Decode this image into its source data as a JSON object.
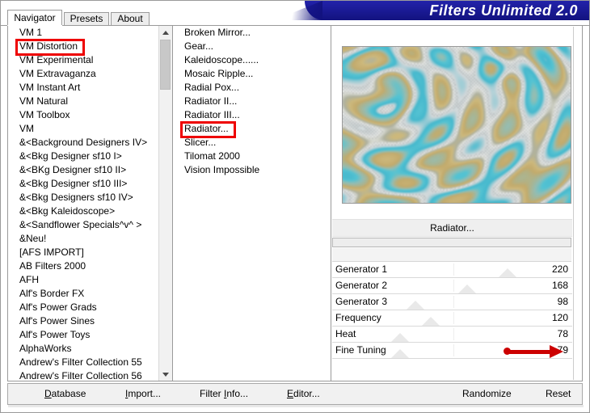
{
  "window": {
    "title": "Filters Unlimited 2.0",
    "accent_color": "#12127f",
    "annotation_color": "#cc0000"
  },
  "tabs": [
    {
      "label": "Navigator",
      "active": true
    },
    {
      "label": "Presets",
      "active": false
    },
    {
      "label": "About",
      "active": false
    }
  ],
  "categories": {
    "scrollbar": {
      "up_icon": "chevron-up-icon",
      "down_icon": "chevron-down-icon"
    },
    "selected": "VM Distortion",
    "items": [
      "VM 1",
      "VM Distortion",
      "VM Experimental",
      "VM Extravaganza",
      "VM Instant Art",
      "VM Natural",
      "VM Toolbox",
      "VM",
      "&<Background Designers IV>",
      "&<Bkg Designer sf10 I>",
      "&<BKg Designer sf10 II>",
      "&<Bkg Designer sf10 III>",
      "&<Bkg Designers sf10 IV>",
      "&<Bkg Kaleidoscope>",
      "&<Sandflower Specials^v^ >",
      "&Neu!",
      "[AFS IMPORT]",
      "AB Filters 2000",
      "AFH",
      "Alf's Border FX",
      "Alf's Power Grads",
      "Alf's Power Sines",
      "Alf's Power Toys",
      "AlphaWorks",
      "Andrew's Filter Collection 55",
      "Andrew's Filter Collection 56"
    ]
  },
  "filters": {
    "selected": "Radiator...",
    "items": [
      "Broken Mirror...",
      "Gear...",
      "Kaleidoscope......",
      "Mosaic Ripple...",
      "Radial Pox...",
      "Radiator II...",
      "Radiator III...",
      "Radiator...",
      "Slicer...",
      "Tilomat 2000",
      "Vision Impossible"
    ]
  },
  "preview": {
    "name": "filter-preview-image",
    "colors": [
      "#3fb8cf",
      "#c2a96b",
      "#ffffff",
      "#9fb8b2",
      "#d9d2b0"
    ]
  },
  "parameters": {
    "header": "Radiator...",
    "progress": 0,
    "rows": [
      {
        "label": "Generator 1",
        "value": 220,
        "pos": 0.87
      },
      {
        "label": "Generator 2",
        "value": 168,
        "pos": 0.66
      },
      {
        "label": "Generator 3",
        "value": 98,
        "pos": 0.39
      },
      {
        "label": "Frequency",
        "value": 120,
        "pos": 0.47
      },
      {
        "label": "Heat",
        "value": 78,
        "pos": 0.31
      },
      {
        "label": "Fine Tuning",
        "value": 79,
        "pos": 0.31
      }
    ]
  },
  "bottom_bar": {
    "left_buttons": [
      {
        "label": "Database",
        "accel": "D"
      },
      {
        "label": "Import...",
        "accel": "I"
      },
      {
        "label": "Filter Info...",
        "accel": "I"
      },
      {
        "label": "Editor...",
        "accel": "E"
      }
    ],
    "right_buttons": [
      {
        "label": "Randomize"
      },
      {
        "label": "Reset"
      }
    ]
  },
  "annotations": {
    "category_highlight": "VM Distortion",
    "filter_highlight": "Radiator...",
    "arrow_target": "79"
  }
}
